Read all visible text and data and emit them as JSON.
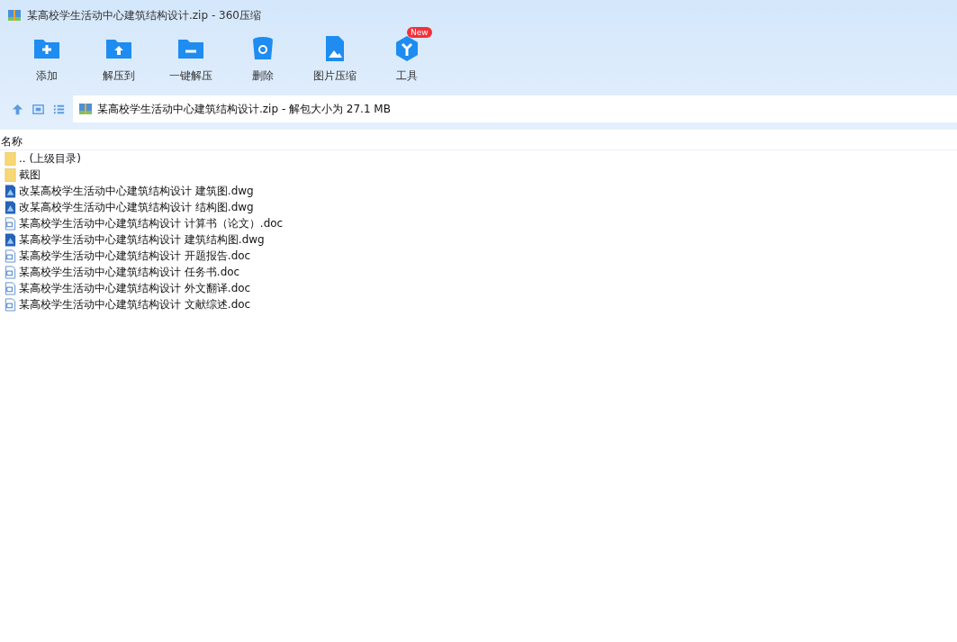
{
  "window": {
    "title": "某高校学生活动中心建筑结构设计.zip - 360压缩"
  },
  "toolbar": [
    {
      "kind": "add",
      "label": "添加"
    },
    {
      "kind": "extract-to",
      "label": "解压到"
    },
    {
      "kind": "extract",
      "label": "一键解压"
    },
    {
      "kind": "delete",
      "label": "删除"
    },
    {
      "kind": "image",
      "label": "图片压缩"
    },
    {
      "kind": "tools",
      "label": "工具",
      "badge": "New"
    }
  ],
  "address_bar": {
    "path": "某高校学生活动中心建筑结构设计.zip - 解包大小为 27.1 MB"
  },
  "table": {
    "columns": [
      "名称"
    ],
    "rows": [
      {
        "kind": "folder",
        "name": ".. (上级目录)"
      },
      {
        "kind": "folder",
        "name": "截图"
      },
      {
        "kind": "dwg",
        "name": "改某高校学生活动中心建筑结构设计 建筑图.dwg"
      },
      {
        "kind": "dwg",
        "name": "改某高校学生活动中心建筑结构设计 结构图.dwg"
      },
      {
        "kind": "doc",
        "name": "某高校学生活动中心建筑结构设计 计算书（论文）.doc"
      },
      {
        "kind": "dwg",
        "name": "某高校学生活动中心建筑结构设计 建筑结构图.dwg"
      },
      {
        "kind": "doc",
        "name": "某高校学生活动中心建筑结构设计 开题报告.doc"
      },
      {
        "kind": "doc",
        "name": "某高校学生活动中心建筑结构设计 任务书.doc"
      },
      {
        "kind": "doc",
        "name": "某高校学生活动中心建筑结构设计 外文翻译.doc"
      },
      {
        "kind": "doc",
        "name": "某高校学生活动中心建筑结构设计 文献综述.doc"
      }
    ]
  }
}
